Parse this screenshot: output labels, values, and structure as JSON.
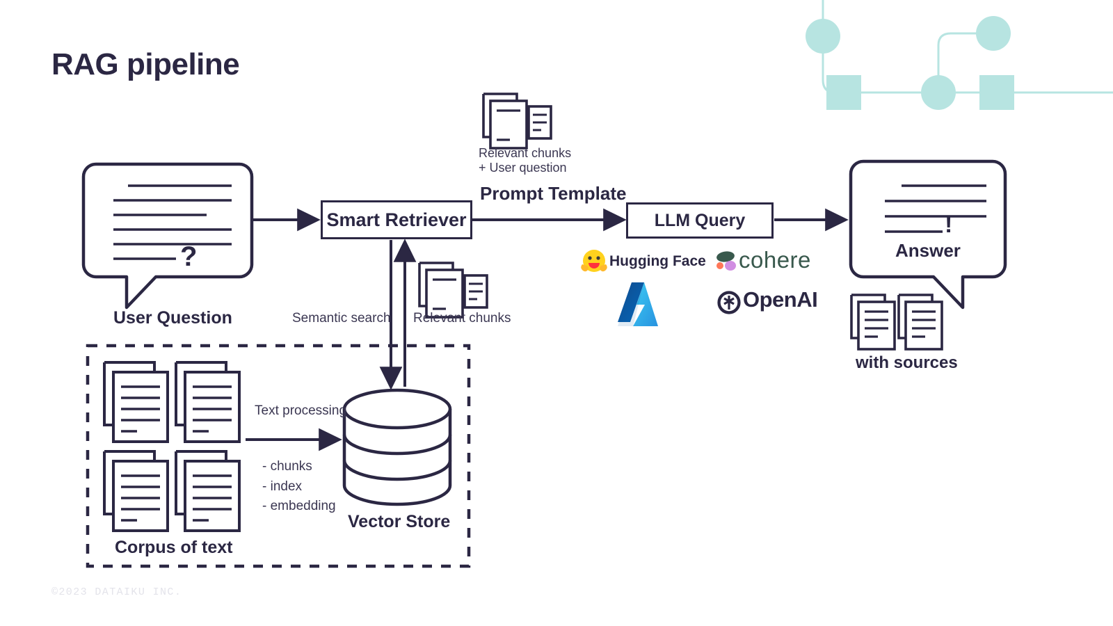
{
  "page": {
    "title": "RAG pipeline",
    "footer": "©2023 DATAIKU INC.",
    "background": "#ffffff",
    "ink": "#2b2743",
    "decor_color": "#b7e4e1"
  },
  "nodes": {
    "user_question": {
      "label": "User Question",
      "bubble_text_lines": 6,
      "bubble_mark": "?"
    },
    "smart_retriever": {
      "label": "Smart Retriever"
    },
    "llm_query": {
      "label": "LLM Query"
    },
    "vector_store": {
      "label": "Vector Store"
    },
    "corpus": {
      "label": "Corpus of text",
      "documents": 4
    },
    "answer": {
      "label": "Answer",
      "bubble_text_lines": 4,
      "bubble_mark": "!"
    },
    "with_sources": {
      "label": "with sources",
      "documents": 2
    }
  },
  "annotations": {
    "prompt_template": "Prompt Template",
    "relevant_chunks_user_question": [
      "Relevant chunks",
      "+ User question"
    ],
    "semantic_search": "Semantic search",
    "relevant_chunks": "Relevant chunks",
    "text_processing": "Text processing",
    "processing_steps": [
      "- chunks",
      "- index",
      "- embedding"
    ]
  },
  "llm_providers": [
    {
      "name": "Hugging Face",
      "icon": "hugging-face-logo",
      "color": "#2b2743"
    },
    {
      "name": "cohere",
      "icon": "cohere-logo",
      "color": "#39594d"
    },
    {
      "name": "Azure",
      "icon": "azure-logo",
      "color": "#0f86d8"
    },
    {
      "name": "OpenAI",
      "icon": "openai-logo",
      "color": "#2b2743"
    }
  ]
}
